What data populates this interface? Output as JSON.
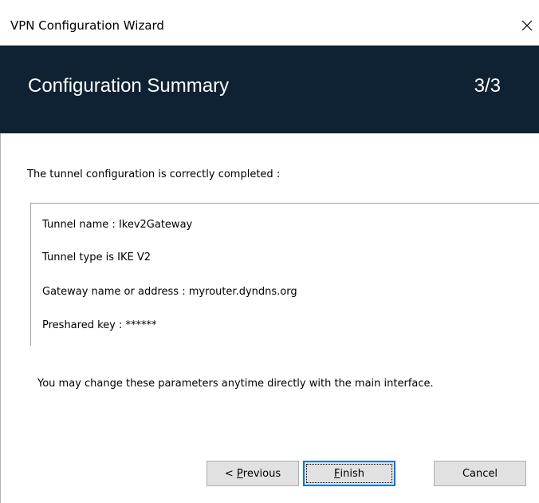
{
  "window": {
    "title": "VPN Configuration Wizard",
    "close_glyph": "✕"
  },
  "header": {
    "title": "Configuration Summary",
    "step": "3/3"
  },
  "content": {
    "intro": "The tunnel configuration is correctly completed :",
    "summary": {
      "tunnel_name": "Tunnel name : Ikev2Gateway",
      "tunnel_type": "Tunnel type is IKE V2",
      "gateway": "Gateway name or address : myrouter.dyndns.org",
      "preshared_key": "Preshared key : ******"
    },
    "note": "You may change these parameters anytime directly with the main interface."
  },
  "buttons": {
    "previous": {
      "prefix": "< ",
      "mnemonic": "P",
      "rest": "revious"
    },
    "finish": {
      "mnemonic": "F",
      "rest": "inish"
    },
    "cancel": "Cancel"
  },
  "colors": {
    "header_background": "#0e2233",
    "header_text": "#ffffff",
    "button_background": "#e1e1e1",
    "focus_border": "#0078d7"
  }
}
